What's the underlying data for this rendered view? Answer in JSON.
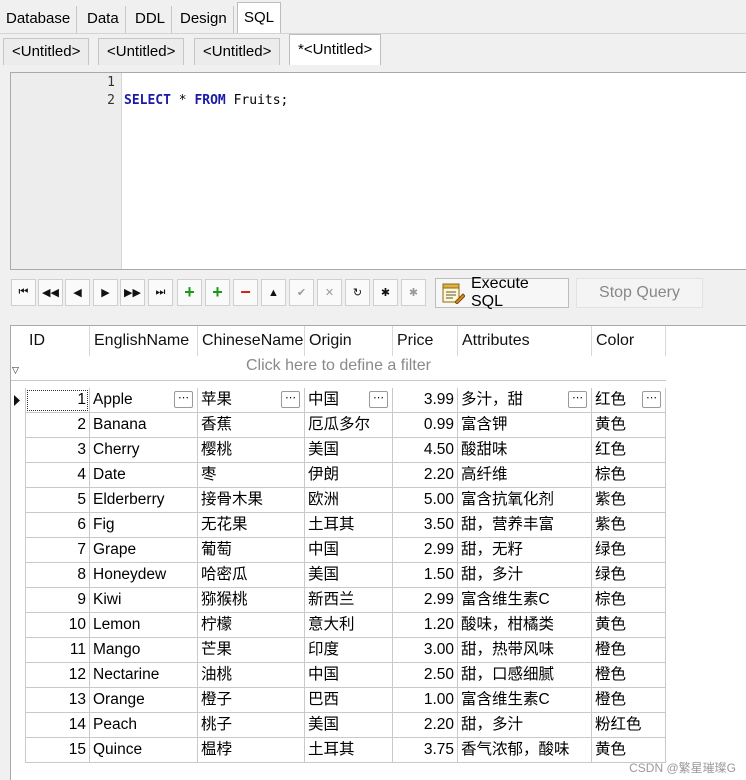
{
  "main_tabs": [
    "Database",
    "Data",
    "DDL",
    "Design",
    "SQL"
  ],
  "sub_tabs": [
    "<Untitled>",
    "<Untitled>",
    "<Untitled>",
    "*<Untitled>"
  ],
  "editor": {
    "line_numbers": [
      "1",
      "2"
    ],
    "line2": {
      "kw1": "SELECT",
      "star": " * ",
      "kw2": "FROM",
      "rest": " Fruits;"
    }
  },
  "toolbar": {
    "execute_label": "Execute SQL",
    "stop_label": "Stop Query"
  },
  "grid": {
    "columns": [
      "ID",
      "EnglishName",
      "ChineseName",
      "Origin",
      "Price",
      "Attributes",
      "Color"
    ],
    "filter_placeholder": "Click here to define a filter",
    "rows": [
      [
        "1",
        "Apple",
        "苹果",
        "中国",
        "3.99",
        "多汁，甜",
        "红色"
      ],
      [
        "2",
        "Banana",
        "香蕉",
        "厄瓜多尔",
        "0.99",
        "富含钾",
        "黄色"
      ],
      [
        "3",
        "Cherry",
        "樱桃",
        "美国",
        "4.50",
        "酸甜味",
        "红色"
      ],
      [
        "4",
        "Date",
        "枣",
        "伊朗",
        "2.20",
        "高纤维",
        "棕色"
      ],
      [
        "5",
        "Elderberry",
        "接骨木果",
        "欧洲",
        "5.00",
        "富含抗氧化剂",
        "紫色"
      ],
      [
        "6",
        "Fig",
        "无花果",
        "土耳其",
        "3.50",
        "甜，营养丰富",
        "紫色"
      ],
      [
        "7",
        "Grape",
        "葡萄",
        "中国",
        "2.99",
        "甜，无籽",
        "绿色"
      ],
      [
        "8",
        "Honeydew",
        "哈密瓜",
        "美国",
        "1.50",
        "甜，多汁",
        "绿色"
      ],
      [
        "9",
        "Kiwi",
        "猕猴桃",
        "新西兰",
        "2.99",
        "富含维生素C",
        "棕色"
      ],
      [
        "10",
        "Lemon",
        "柠檬",
        "意大利",
        "1.20",
        "酸味，柑橘类",
        "黄色"
      ],
      [
        "11",
        "Mango",
        "芒果",
        "印度",
        "3.00",
        "甜，热带风味",
        "橙色"
      ],
      [
        "12",
        "Nectarine",
        "油桃",
        "中国",
        "2.50",
        "甜，口感细腻",
        "橙色"
      ],
      [
        "13",
        "Orange",
        "橙子",
        "巴西",
        "1.00",
        "富含维生素C",
        "橙色"
      ],
      [
        "14",
        "Peach",
        "桃子",
        "美国",
        "2.20",
        "甜，多汁",
        "粉红色"
      ],
      [
        "15",
        "Quince",
        "榅桲",
        "土耳其",
        "3.75",
        "香气浓郁，酸味",
        "黄色"
      ]
    ]
  },
  "watermark": "CSDN @繁星璀璨G"
}
